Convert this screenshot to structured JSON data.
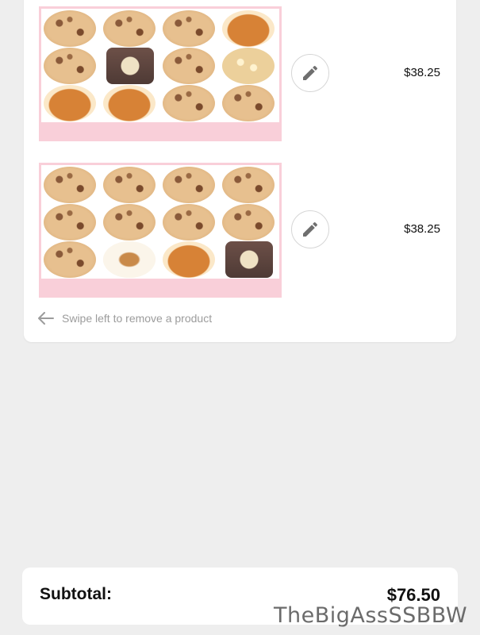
{
  "cart": {
    "products": [
      {
        "price": "$38.25",
        "image_alt": "Box of 12 cookies"
      },
      {
        "price": "$38.25",
        "image_alt": "Box of 12 cookies"
      }
    ],
    "swipe_hint": "Swipe left to remove a product"
  },
  "summary": {
    "subtotal_label": "Subtotal:",
    "subtotal_value": "$76.50"
  },
  "watermark": "TheBigAssSSBBW",
  "icons": {
    "edit": "pencil-icon",
    "swipe": "arrow-left-icon"
  },
  "colors": {
    "page_bg": "#eeeeee",
    "card_bg": "#ffffff",
    "image_frame": "#f9cfd9",
    "hint_text": "#9c9c9c"
  }
}
